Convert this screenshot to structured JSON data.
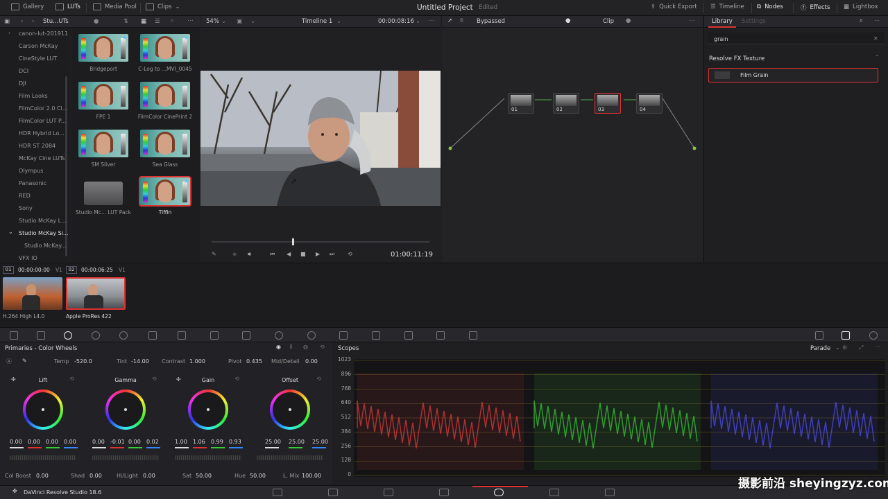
{
  "topbar": {
    "gallery": "Gallery",
    "luts": "LUTs",
    "media_pool": "Media Pool",
    "clips": "Clips",
    "project_title": "Untitled Project",
    "edited": "Edited",
    "quick_export": "Quick Export",
    "timeline": "Timeline",
    "nodes": "Nodes",
    "effects": "Effects",
    "lightbox": "Lightbox"
  },
  "lut_bar": {
    "folder": "Stu...UTs"
  },
  "lut_list": [
    "canon-lut-201911",
    "Carson McKay",
    "CineStyle LUT",
    "DCI",
    "DJI",
    "Film Looks",
    "FilmColor 2.0 Cl...",
    "FilmColor LUT P...",
    "HDR Hybrid Lo...",
    "HDR ST 2084",
    "McKay Cine LUTs",
    "Olympus",
    "Panasonic",
    "RED",
    "Sony",
    "Studio McKay L...",
    "Studio McKay Si...",
    "Studio McKay...",
    "VFX IO"
  ],
  "lut_thumbs": [
    {
      "label": "Bridgeport"
    },
    {
      "label": "C-Log to ...MVI_0045"
    },
    {
      "label": "FPE 1"
    },
    {
      "label": "FilmColor CinePrint 2"
    },
    {
      "label": "SM Silver"
    },
    {
      "label": "Sea Glass"
    },
    {
      "label": "Studio Mc... LUT Pack"
    },
    {
      "label": "Tiffin"
    }
  ],
  "viewer": {
    "zoom": "54%",
    "timeline_name": "Timeline 1",
    "timecode_top": "00:00:08:16",
    "timecode": "01:00:11:19",
    "scrub_position": 0.37
  },
  "nodes_bar": {
    "bypassed": "Bypassed",
    "mode": "Clip"
  },
  "nodes": [
    {
      "label": "01"
    },
    {
      "label": "02"
    },
    {
      "label": "03"
    },
    {
      "label": "04"
    }
  ],
  "right_panel": {
    "tab_library": "Library",
    "tab_settings": "Settings",
    "search_value": "grain",
    "section": "Resolve FX Texture",
    "result": "Film Grain"
  },
  "clips": [
    {
      "num": "01",
      "tc": "00:00:00:00",
      "track": "V1",
      "codec": "H.264 High L4.0"
    },
    {
      "num": "02",
      "tc": "00:00:06:25",
      "track": "V1",
      "codec": "Apple ProRes 422"
    }
  ],
  "primaries": {
    "title": "Primaries - Color Wheels",
    "temp_label": "Temp",
    "temp": "-520.0",
    "tint_label": "Tint",
    "tint": "-14.00",
    "contrast_label": "Contrast",
    "contrast": "1.000",
    "pivot_label": "Pivot",
    "pivot": "0.435",
    "middetail_label": "Mid/Detail",
    "middetail": "0.00",
    "wheels": [
      {
        "name": "Lift",
        "values": [
          "0.00",
          "0.00",
          "0.00",
          "0.00"
        ]
      },
      {
        "name": "Gamma",
        "values": [
          "0.00",
          "-0.01",
          "0.00",
          "0.02"
        ]
      },
      {
        "name": "Gain",
        "values": [
          "1.00",
          "1.06",
          "0.99",
          "0.93"
        ]
      },
      {
        "name": "Offset",
        "values": [
          "25.00",
          "25.00",
          "25.00"
        ]
      }
    ],
    "colboost_label": "Col Boost",
    "colboost": "0.00",
    "shad_label": "Shad",
    "shad": "0.00",
    "hilight_label": "Hi/Light",
    "hilight": "0.00",
    "sat_label": "Sat",
    "sat": "50.00",
    "hue_label": "Hue",
    "hue": "50.00",
    "lmix_label": "L. Mix",
    "lmix": "100.00"
  },
  "scopes": {
    "title": "Scopes",
    "mode": "Parade",
    "ticks": [
      "1023",
      "896",
      "768",
      "640",
      "512",
      "384",
      "256",
      "128",
      "0"
    ]
  },
  "bottom": {
    "app_name": "DaVinci Resolve Studio 18.6"
  },
  "watermark": "摄影前沿 sheyingzyz.com",
  "colors": {
    "accent_red": "#d33333",
    "node_link": "#4caf50"
  }
}
